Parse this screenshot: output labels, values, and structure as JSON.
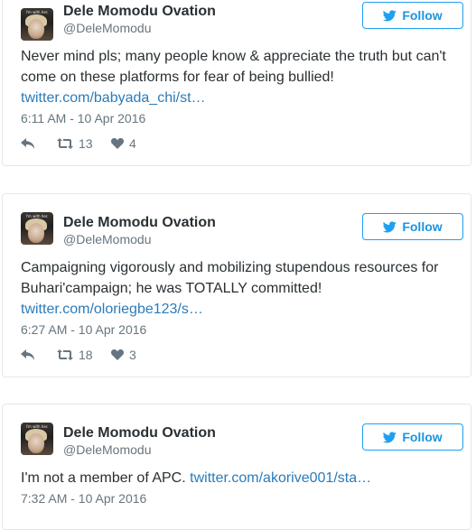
{
  "tweets": [
    {
      "name": "Dele Momodu Ovation",
      "handle": "@DeleMomodu",
      "follow_label": "Follow",
      "text": "Never mind pls; many people know & appreciate the truth but can't come on these platforms for fear of being bullied!",
      "link": "twitter.com/babyada_chi/st…",
      "time": "6:11 AM - 10 Apr 2016",
      "retweets": "13",
      "likes": "4",
      "avatar_caption": "I'm with her."
    },
    {
      "name": "Dele Momodu Ovation",
      "handle": "@DeleMomodu",
      "follow_label": "Follow",
      "text": "Campaigning vigorously and mobilizing stupendous resources for Buhari'campaign; he was TOTALLY committed!",
      "link": "twitter.com/oloriegbe123/s…",
      "time": "6:27 AM - 10 Apr 2016",
      "retweets": "18",
      "likes": "3",
      "avatar_caption": "I'm with her."
    },
    {
      "name": "Dele Momodu Ovation",
      "handle": "@DeleMomodu",
      "follow_label": "Follow",
      "text": "I'm not a member of APC.",
      "link": "twitter.com/akorive001/sta…",
      "time": "7:32 AM - 10 Apr 2016",
      "avatar_caption": "I'm with her."
    }
  ],
  "colors": {
    "accent": "#1da1f2",
    "link": "#2b7bb9",
    "muted": "#66757f",
    "border": "#e1e8ed"
  },
  "icons": {
    "follow": "twitter-bird-icon",
    "reply": "reply-icon",
    "retweet": "retweet-icon",
    "like": "heart-icon"
  }
}
